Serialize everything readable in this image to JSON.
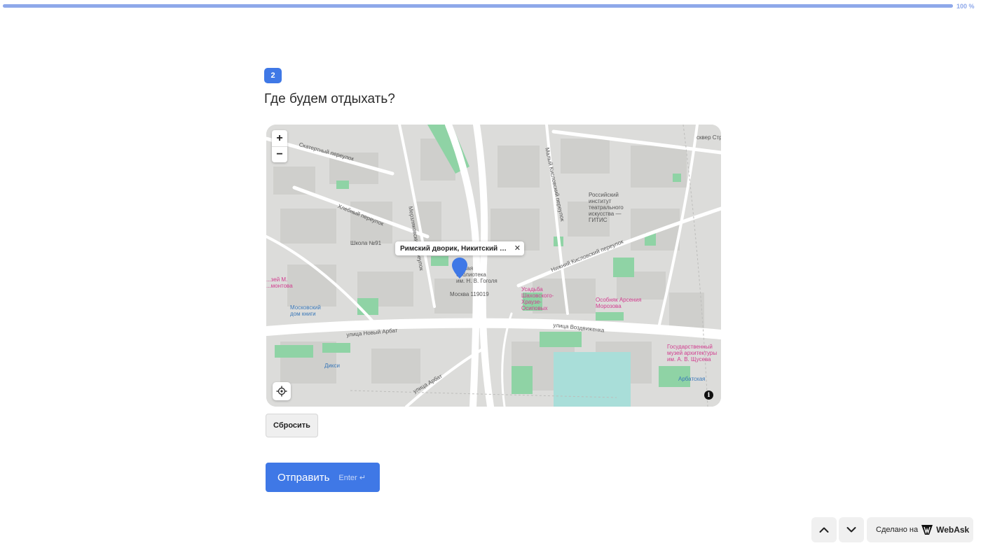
{
  "progress": {
    "label": "100 %",
    "value": 100
  },
  "question": {
    "number": "2",
    "title": "Где будем отдыхать?"
  },
  "map": {
    "zoom_in": "+",
    "zoom_out": "−",
    "info": "i",
    "popup": {
      "text": "Римский дворик, Никитский бульвар",
      "close": "✕"
    },
    "marker_color": "#3f78e6",
    "labels": {
      "skatertny": "Скатертный переулок",
      "khlebny": "Хлебный переулок",
      "merzlyakovsky": "Мерзляковский переулок",
      "maly_kislovsky": "Малый Кисловский переулок",
      "nizhny_kislovsky": "Нижний Кисловский переулок",
      "novy_arbat": "улица Новый Арбат",
      "vozdvizhenka": "улица Воздвиженка",
      "arbat": "улица Арбат",
      "school": "Школа №91",
      "gitis": "Российский\nинститут\nтеатрального\nискусства —\nГИТИС",
      "library": "...чная\nбиблиотека\nим. Н. В. Гоголя",
      "postcode": "Москва 119019",
      "museum_m": "...зей М.\n...монтова",
      "dom_knigi": "Московский\nдом книги",
      "usadba": "Усадьба\nШаховского-\nХраузе-\nОсиповых",
      "osobnyak": "Особняк Арсения\nМорозова",
      "museum_arch": "Государственный\nмузей архитектуры\nим. А. В. Щусева",
      "arbatskaya": "Арбатская",
      "diksi": "Дикси",
      "skver": "сквер Стр..."
    }
  },
  "reset_label": "Сбросить",
  "submit": {
    "label": "Отправить",
    "hint": "Enter ↵"
  },
  "footer": {
    "made_with": "Сделано на",
    "brand": "WebAsk"
  }
}
